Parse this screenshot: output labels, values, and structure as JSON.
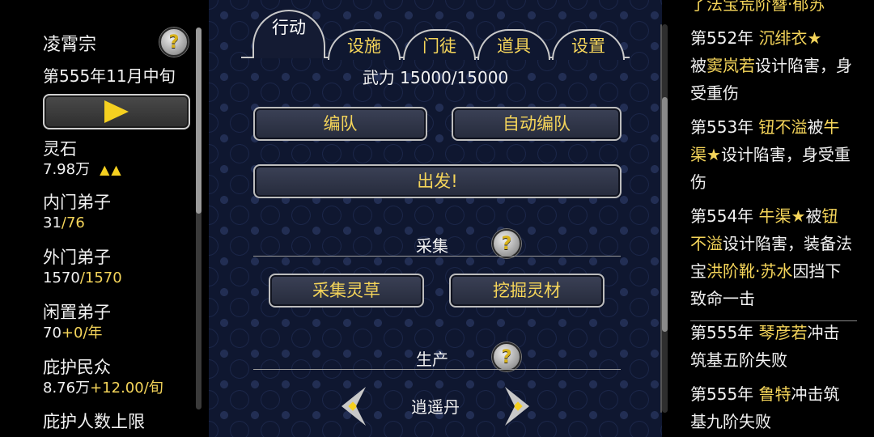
{
  "left": {
    "sect_name": "凌霄宗",
    "date": "第555年11月中旬",
    "help": "?",
    "play_icon": "play-triangle-icon",
    "spirit_stone": {
      "label": "灵石",
      "value": "7.98万",
      "trend": "▲▲"
    },
    "inner_disciples": {
      "label": "内门弟子",
      "current": "31",
      "max": "/76"
    },
    "outer_disciples": {
      "label": "外门弟子",
      "current": "1570",
      "max": "/1570"
    },
    "idle_disciples": {
      "label": "闲置弟子",
      "current": "70",
      "rate": "+0/年"
    },
    "protected_people": {
      "label": "庇护民众",
      "current": "8.76万",
      "rate": "+12.00/旬"
    },
    "protect_limit": {
      "label": "庇护人数上限"
    }
  },
  "center": {
    "tabs": [
      "行动",
      "设施",
      "门徒",
      "道具",
      "设置"
    ],
    "power": "武力 15000/15000",
    "buttons": {
      "form_team": "编队",
      "auto_form_team": "自动编队",
      "depart": "出发!"
    },
    "gather": {
      "title": "采集",
      "help": "?",
      "collect_herbs": "采集灵草",
      "mine_materials": "挖掘灵材"
    },
    "produce": {
      "title": "生产",
      "help": "?",
      "product": "逍遥丹"
    }
  },
  "right": {
    "log_top": "了法宝荒阶簪·郁苏",
    "entries": [
      {
        "year": "第552年",
        "name": "沉绯衣★",
        "p1": "被",
        "name2": "窦岚若",
        "p2": "设计陷害，身受重伤"
      },
      {
        "year": "第553年",
        "name": "钮不溢",
        "p1": "被",
        "name2": "牛渠★",
        "p2": "设计陷害，身受重伤"
      },
      {
        "year": "第554年",
        "name": "牛渠★",
        "p1": "被",
        "name2": "钮不溢",
        "p2": "设计陷害，装备法宝",
        "item": "洪阶靴·苏水",
        "p3": "因挡下致命一击"
      },
      {
        "year": "第555年",
        "name": "琴彦若",
        "p1": "冲击筑基五阶失败"
      },
      {
        "year": "第555年",
        "name": "鲁特",
        "p1": "冲击筑基九阶失败"
      }
    ]
  },
  "colors": {
    "accent_gold": "#f5d55a",
    "panel_bg": "#0f1730",
    "side_bg": "#000000"
  }
}
